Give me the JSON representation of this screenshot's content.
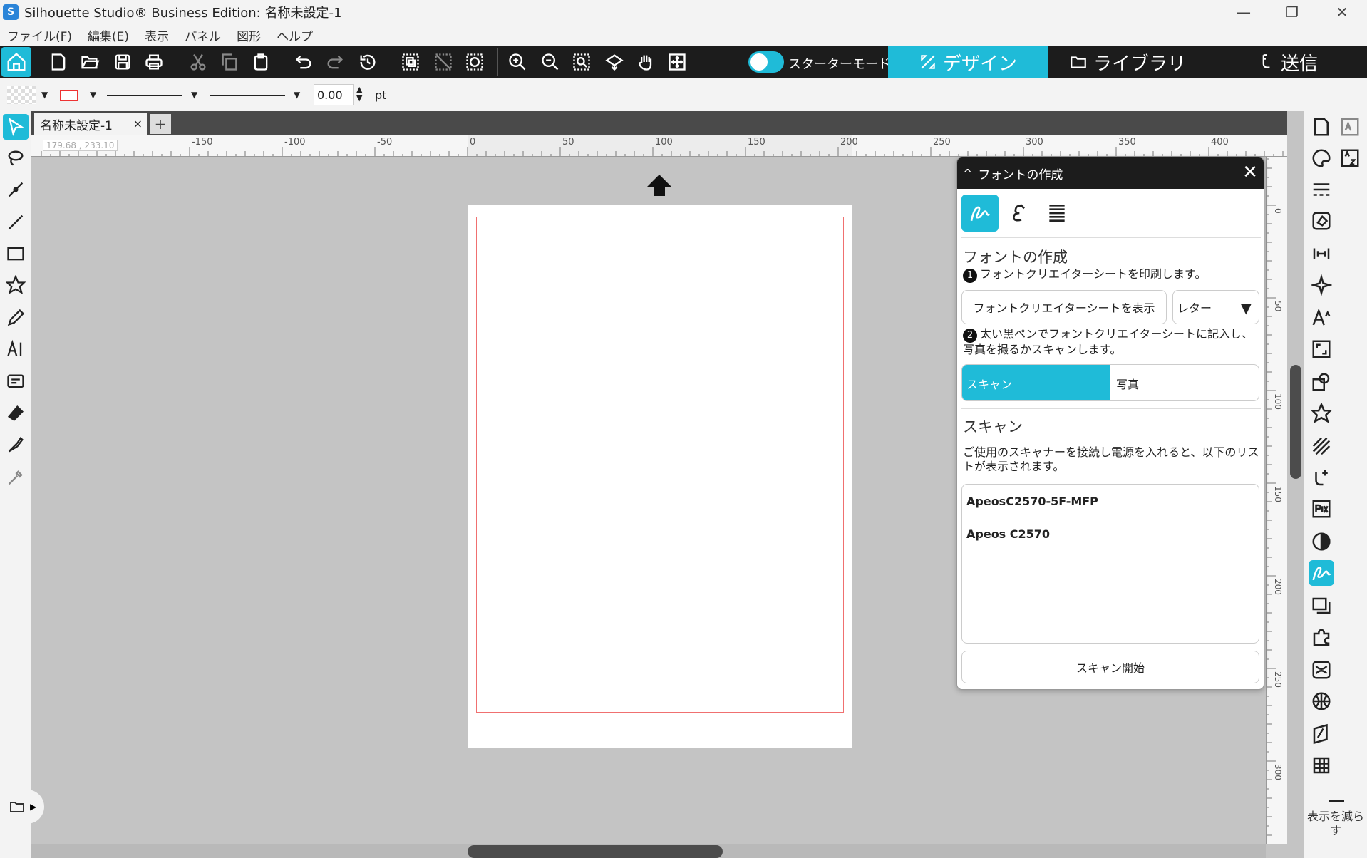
{
  "window": {
    "title": "Silhouette Studio® Business Edition: 名称未設定-1",
    "min_glyph": "—",
    "max_glyph": "❐",
    "close_glyph": "✕"
  },
  "menu": [
    "ファイル(F)",
    "編集(E)",
    "表示",
    "パネル",
    "図形",
    "ヘルプ"
  ],
  "toolbar": {
    "starter_mode_label": "スターターモードオフ",
    "tabs": {
      "design": "デザイン",
      "library": "ライブラリ",
      "send": "送信"
    },
    "icons": [
      "home-icon",
      "new-document-icon",
      "open-folder-icon",
      "save-icon",
      "print-icon",
      "cut-icon",
      "copy-icon",
      "paste-icon",
      "undo-icon",
      "redo-icon",
      "history-icon",
      "group-icon",
      "ungroup-icon",
      "release-icon",
      "zoom-in-icon",
      "zoom-out-icon",
      "zoom-selection-icon",
      "pan-icon",
      "hand-icon",
      "fit-to-page-icon"
    ]
  },
  "properties": {
    "line_weight": "0.00",
    "unit": "pt",
    "fill_color": "#ffffff",
    "stroke_color": "#e33333"
  },
  "document": {
    "tab_label": "名称未設定-1",
    "tab_close": "×",
    "add_tab": "+",
    "cursor_coords": "179.68 , 233.10"
  },
  "ruler": {
    "h_labels": [
      "-150",
      "-100",
      "-50",
      "0",
      "50",
      "100",
      "150",
      "200",
      "250",
      "300",
      "350",
      "400"
    ],
    "v_labels": [
      "0",
      "50",
      "100",
      "150",
      "200",
      "250",
      "300"
    ]
  },
  "font_panel": {
    "header": "フォントの作成",
    "close": "✕",
    "section_title": "フォントの作成",
    "step1": "フォントクリエイターシートを印刷します。",
    "step1_num": "1",
    "show_sheet_button": "フォントクリエイターシートを表示",
    "paper_select": "レター",
    "step2": "太い黒ペンでフォントクリエイターシートに記入し、写真を撮るかスキャンします。",
    "step2_num": "2",
    "seg_scan": "スキャン",
    "seg_photo": "写真",
    "scan_title": "スキャン",
    "scan_desc": "ご使用のスキャナーを接続し電源を入れると、以下のリストが表示されます。",
    "scanners": [
      "ApeosC2570-5F-MFP",
      "Apeos C2570"
    ],
    "scan_start": "スキャン開始"
  },
  "right_panel": {
    "show_less": "表示を減らす"
  },
  "colors": {
    "accent": "#1fbbd8",
    "toolbar_bg": "#1c1c1c",
    "canvas_bg": "#c4c4c4"
  }
}
